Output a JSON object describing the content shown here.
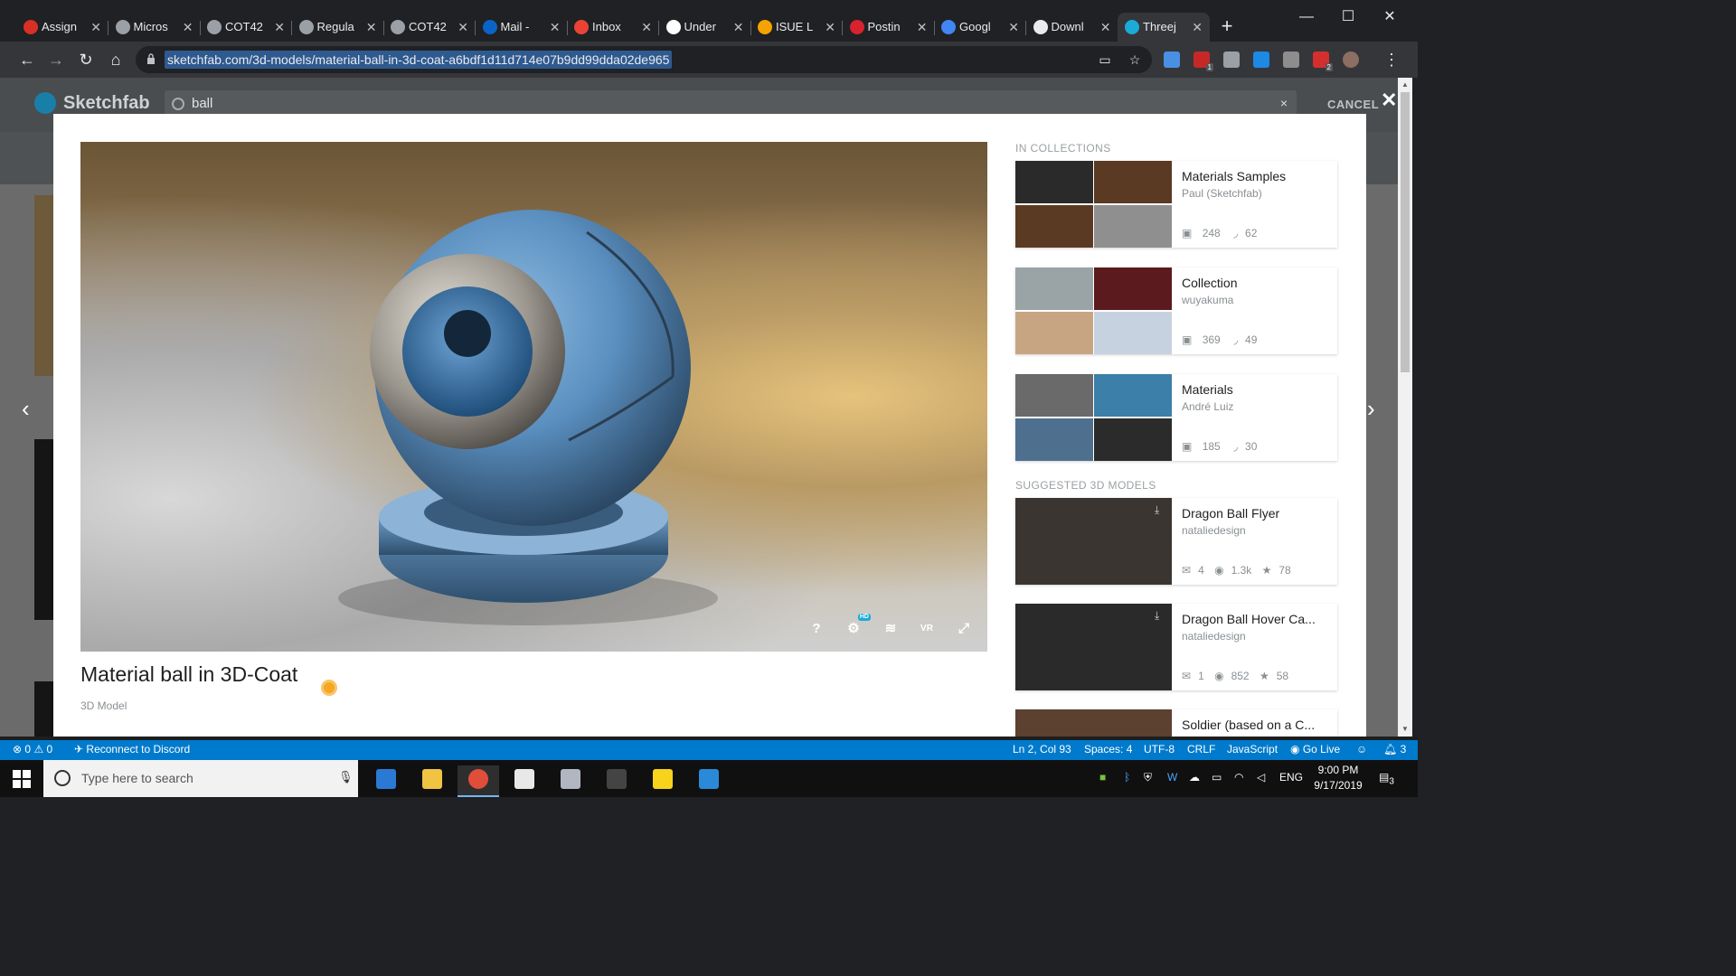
{
  "browser": {
    "tabs": [
      {
        "label": "Assign",
        "icon_color": "#d93025"
      },
      {
        "label": "Micros",
        "icon_color": "#9aa0a6"
      },
      {
        "label": "COT42",
        "icon_color": "#9aa0a6"
      },
      {
        "label": "Regula",
        "icon_color": "#9aa0a6"
      },
      {
        "label": "COT42",
        "icon_color": "#9aa0a6"
      },
      {
        "label": "Mail -",
        "icon_color": "#0a64c8"
      },
      {
        "label": "Inbox",
        "icon_color": "#ea4335"
      },
      {
        "label": "Under",
        "icon_color": "#ffffff"
      },
      {
        "label": "ISUE L",
        "icon_color": "#f4a300"
      },
      {
        "label": "Postin",
        "icon_color": "#d92230"
      },
      {
        "label": "Googl",
        "icon_color": "#4285f4"
      },
      {
        "label": "Downl",
        "icon_color": "#e8eaed"
      },
      {
        "label": "Threej",
        "icon_color": "#1caad9",
        "active": true
      }
    ],
    "new_tab": "+",
    "window_controls": {
      "minimize": "—",
      "maximize": "☐",
      "close": "✕"
    },
    "url": "sketchfab.com/3d-models/material-ball-in-3d-coat-a6bdf1d11d714e07b9dd99dda02de965",
    "extensions": [
      {
        "name": "translate-extension-icon",
        "color": "#4a90e2",
        "badge": ""
      },
      {
        "name": "adblock-extension-icon",
        "color": "#c62828",
        "badge": "1"
      },
      {
        "name": "ghost-extension-icon",
        "color": "#9aa0a6",
        "badge": ""
      },
      {
        "name": "bookmark-extension-icon",
        "color": "#1e88e5",
        "badge": ""
      },
      {
        "name": "kami-extension-icon",
        "color": "#8d8d8d",
        "badge": ""
      },
      {
        "name": "shield-extension-icon",
        "color": "#d32f2f",
        "badge": "2"
      },
      {
        "name": "profile-avatar",
        "color": "#8d6e63",
        "badge": ""
      }
    ]
  },
  "sketchfab": {
    "logo": "Sketchfab",
    "search_query": "ball",
    "search_clear": "×",
    "cancel_label": "CANCEL",
    "close_popup": "✕",
    "prev_arrow": "‹",
    "next_arrow": "›"
  },
  "model": {
    "title": "Material ball in 3D-Coat",
    "subtitle": "3D Model",
    "viewer_controls": {
      "help": "?",
      "settings_badge": "HD",
      "layers": "≋",
      "vr": "VR",
      "fullscreen": "⤢"
    }
  },
  "collections_label": "IN COLLECTIONS",
  "collections": [
    {
      "title": "Materials Samples",
      "author": "Paul (Sketchfab)",
      "models": "248",
      "likes": "62",
      "thumb_colors": [
        "#2a2a2a",
        "#5a3a22",
        "#5b3a24",
        "#8f8f8f"
      ]
    },
    {
      "title": "Collection",
      "author": "wuyakuma",
      "models": "369",
      "likes": "49",
      "thumb_colors": [
        "#9aa3a6",
        "#5a1a1e",
        "#c8a582",
        "#c7d2e0"
      ]
    },
    {
      "title": "Materials",
      "author": "André Luiz",
      "models": "185",
      "likes": "30",
      "thumb_colors": [
        "#6a6a6a",
        "#3c7fa8",
        "#4f6f8f",
        "#2b2b2b"
      ]
    }
  ],
  "suggested_label": "SUGGESTED 3D MODELS",
  "suggested": [
    {
      "title": "Dragon Ball Flyer",
      "author": "nataliedesign",
      "comments": "4",
      "views": "1.3k",
      "likes": "78",
      "thumb_color": "#3a3530"
    },
    {
      "title": "Dragon Ball Hover Ca...",
      "author": "nataliedesign",
      "comments": "1",
      "views": "852",
      "likes": "58",
      "thumb_color": "#2a2a2a"
    },
    {
      "title": "Soldier (based on a C...",
      "author": "",
      "comments": "",
      "views": "",
      "likes": "",
      "thumb_color": "#5c4030"
    }
  ],
  "statusbar": {
    "errors": "0",
    "warnings": "0",
    "discord": "Reconnect to Discord",
    "position": "Ln 2, Col 93",
    "spaces": "Spaces: 4",
    "encoding": "UTF-8",
    "eol": "CRLF",
    "language": "JavaScript",
    "golive": "Go Live",
    "notifications": "3"
  },
  "taskbar": {
    "search_placeholder": "Type here to search",
    "apps": [
      {
        "name": "edge-app-icon",
        "color": "#2a7ad5",
        "active": false
      },
      {
        "name": "file-explorer-app-icon",
        "color": "#f0c343",
        "active": false
      },
      {
        "name": "chrome-app-icon",
        "color": "#e14d3b",
        "active": true
      },
      {
        "name": "slack-app-icon",
        "color": "#e8e8e8",
        "active": false
      },
      {
        "name": "paint-app-icon",
        "color": "#b0b7c3",
        "active": false
      },
      {
        "name": "terminal-app-icon",
        "color": "#444444",
        "active": false
      },
      {
        "name": "sticky-notes-app-icon",
        "color": "#f7d31c",
        "active": false
      },
      {
        "name": "vscode-app-icon",
        "color": "#2a8ad8",
        "active": false
      }
    ],
    "language": "ENG",
    "time": "9:00 PM",
    "date": "9/17/2019",
    "notification_count": "3"
  }
}
